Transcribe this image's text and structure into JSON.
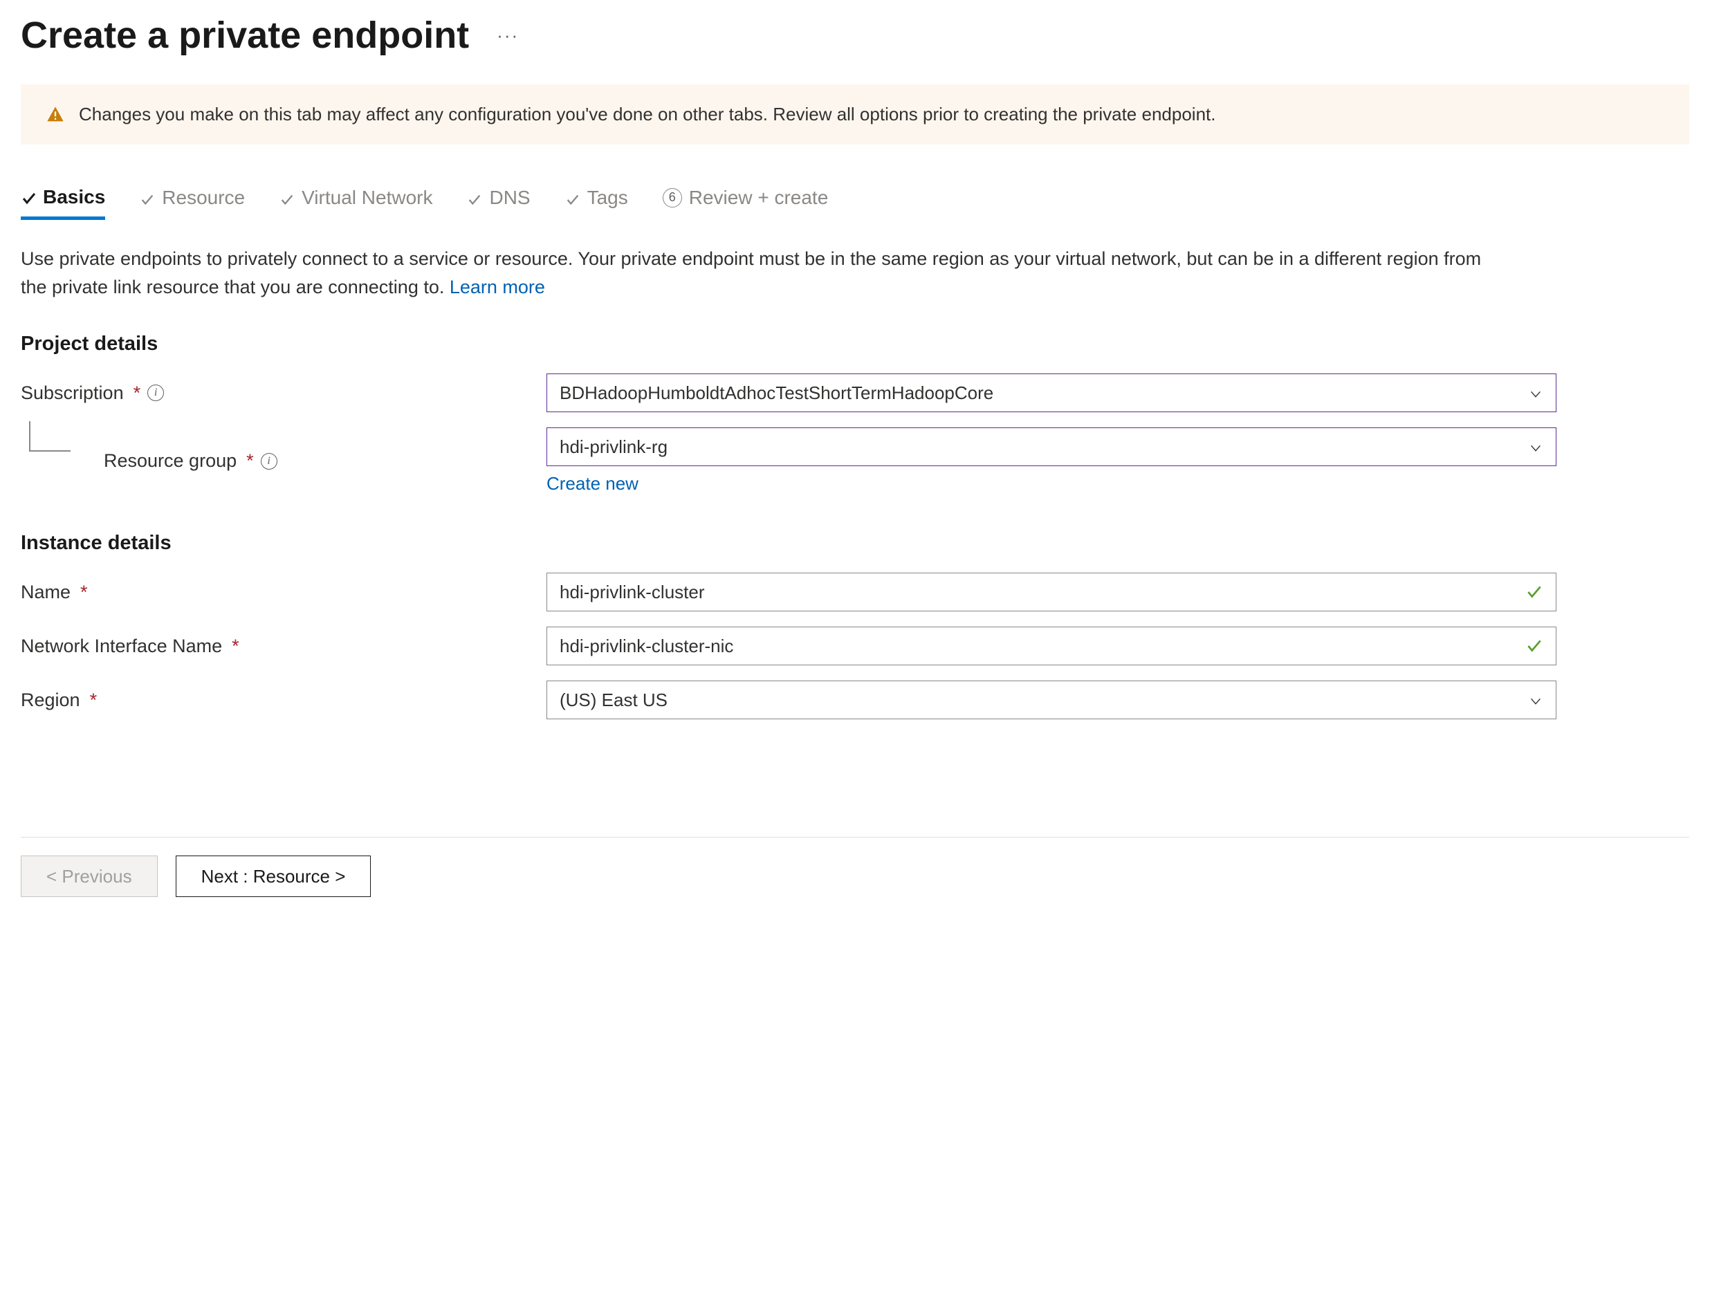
{
  "header": {
    "title": "Create a private endpoint"
  },
  "warning": {
    "text": "Changes you make on this tab may affect any configuration you've done on other tabs. Review all options prior to creating the private endpoint."
  },
  "tabs": {
    "basics": "Basics",
    "resource": "Resource",
    "vnet": "Virtual Network",
    "dns": "DNS",
    "tags": "Tags",
    "review": "Review + create",
    "review_num": "6"
  },
  "description": {
    "text": "Use private endpoints to privately connect to a service or resource. Your private endpoint must be in the same region as your virtual network, but can be in a different region from the private link resource that you are connecting to.  ",
    "learn_more": "Learn more"
  },
  "sections": {
    "project_details": "Project details",
    "instance_details": "Instance details"
  },
  "fields": {
    "subscription": {
      "label": "Subscription",
      "value": "BDHadoopHumboldtAdhocTestShortTermHadoopCore"
    },
    "resource_group": {
      "label": "Resource group",
      "value": "hdi-privlink-rg",
      "create_new": "Create new"
    },
    "name": {
      "label": "Name",
      "value": "hdi-privlink-cluster"
    },
    "nic_name": {
      "label": "Network Interface Name",
      "value": "hdi-privlink-cluster-nic"
    },
    "region": {
      "label": "Region",
      "value": "(US) East US"
    }
  },
  "footer": {
    "prev": "< Previous",
    "next": "Next : Resource >"
  }
}
